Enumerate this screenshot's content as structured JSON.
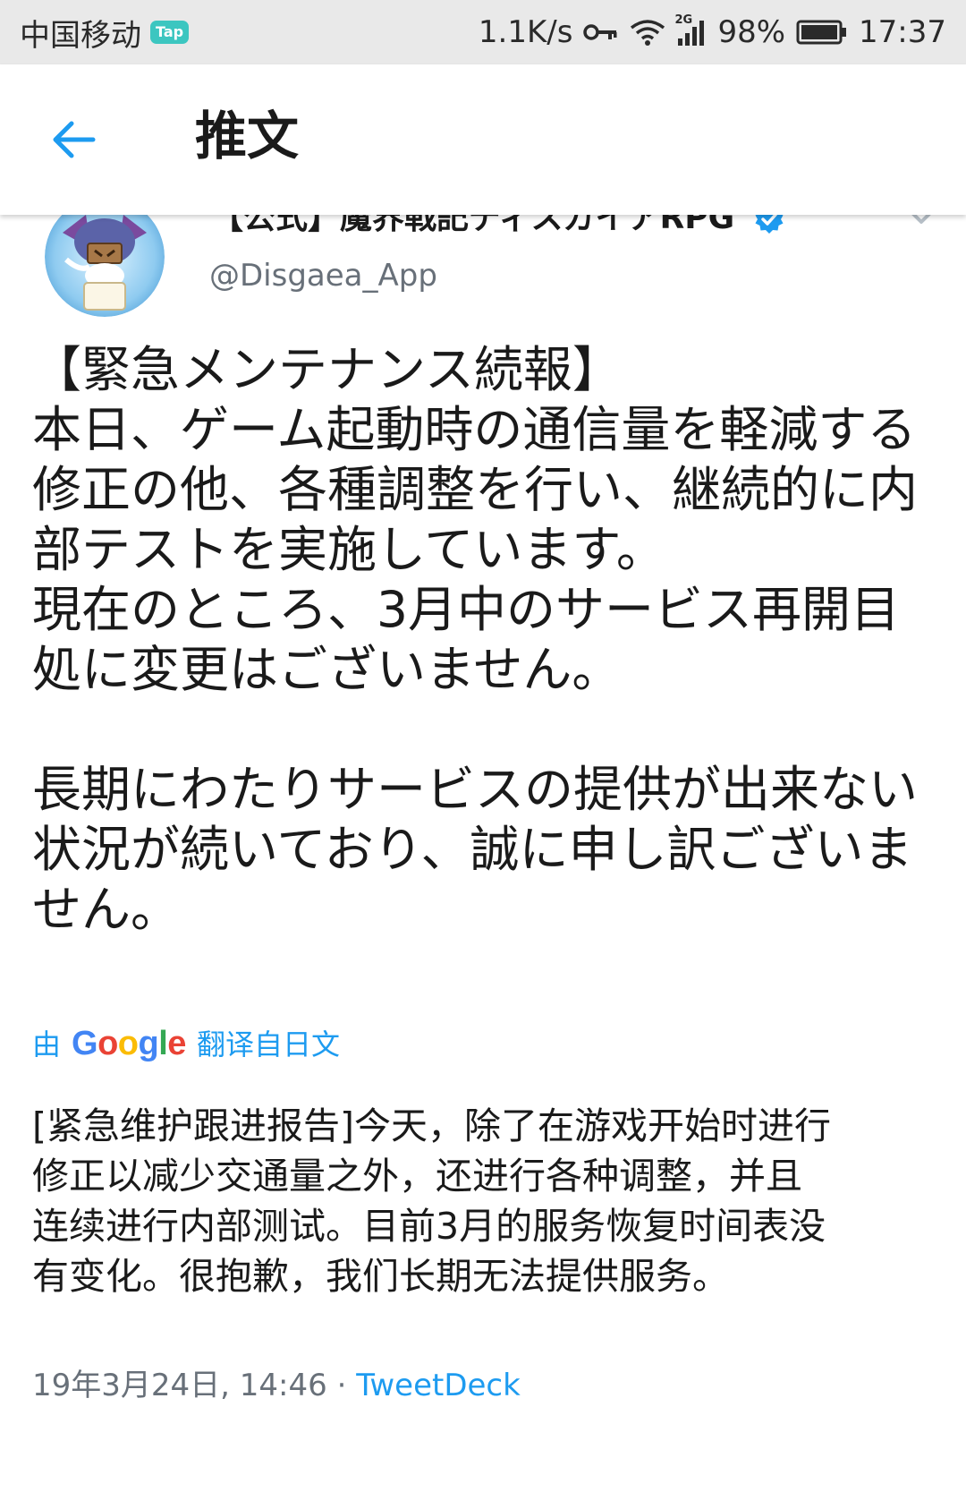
{
  "status_bar": {
    "carrier": "中国移动",
    "carrier_badge": "Tap",
    "net_speed": "1.1K/s",
    "network_type": "2G",
    "battery": "98%",
    "time": "17:37",
    "icons": [
      "key-icon",
      "wifi-icon",
      "signal-icon",
      "battery-icon"
    ]
  },
  "header": {
    "title": "推文",
    "back_icon": "arrow-left-icon",
    "accent_color": "#1d9bf0"
  },
  "tweet": {
    "display_name": "【公式】魔界戦記ディスガイアRPG",
    "verified": true,
    "screen_name": "@Disgaea_App",
    "text_paragraph_1": "【緊急メンテナンス続報】\n本日、ゲーム起動時の通信量を軽減する\n修正の他、各種調整を行い、継続的に内\n部テストを実施しています。\n現在のところ、3月中のサービス再開目\n処に変更はございません。",
    "text_paragraph_2": "長期にわたりサービスの提供が出来ない\n状況が続いており、誠に申し訳ございま\nせん。",
    "translate": {
      "prefix": "由",
      "provider": "Google",
      "suffix": "翻译自日文"
    },
    "translated_text": "[紧急维护跟进报告]今天，除了在游戏开始时进行\n修正以减少交通量之外，还进行各种调整，并且\n连续进行内部测试。目前3月的服务恢复时间表没\n有变化。很抱歉，我们长期无法提供服务。",
    "timestamp": "19年3月24日, 14:46",
    "separator": "·",
    "source": "TweetDeck"
  }
}
